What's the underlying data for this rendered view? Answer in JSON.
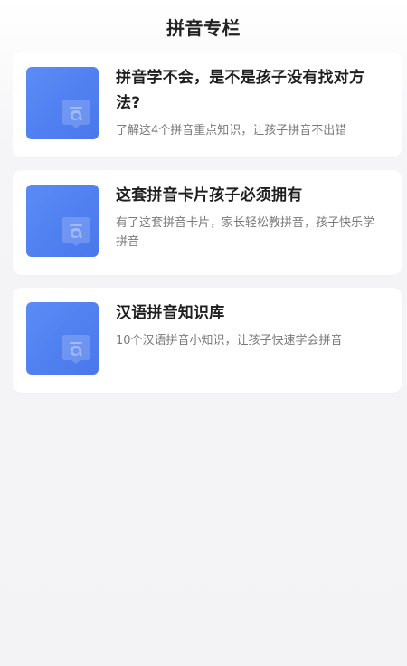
{
  "header": {
    "title": "拼音专栏"
  },
  "articles": [
    {
      "title": "拼音学不会，是不是孩子没有找对方法?",
      "description": "了解这4个拼音重点知识，让孩子拼音不出错",
      "thumbnail_icon": "pinyin-a-tone-icon"
    },
    {
      "title": "这套拼音卡片孩子必须拥有",
      "description": "有了这套拼音卡片，家长轻松教拼音，孩子快乐学拼音",
      "thumbnail_icon": "pinyin-a-tone-icon"
    },
    {
      "title": "汉语拼音知识库",
      "description": "10个汉语拼音小知识，让孩子快速学会拼音",
      "thumbnail_icon": "pinyin-a-tone-icon"
    }
  ],
  "colors": {
    "thumbnail_blue": "#5b8cf5",
    "background": "#f4f4f6",
    "title_text": "#1f1f1f",
    "desc_text": "#7a7a7a"
  }
}
